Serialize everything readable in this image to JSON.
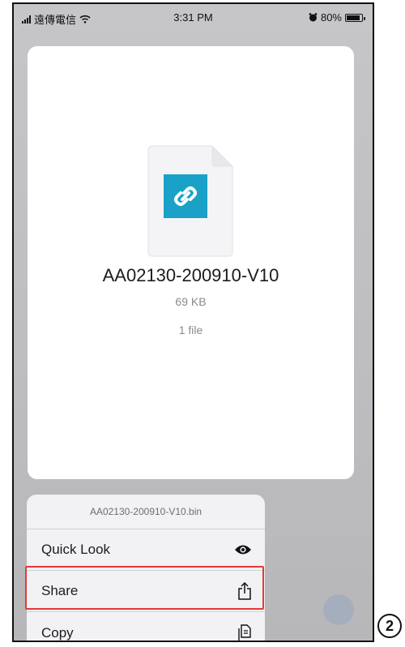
{
  "status_bar": {
    "carrier": "遠傳電信",
    "time": "3:31 PM",
    "battery": "80%",
    "battery_level": 0.8
  },
  "preview": {
    "file_name": "AA02130-200910-V10",
    "file_size": "69 KB",
    "file_count": "1 file",
    "app_color": "#1aa1c8"
  },
  "menu": {
    "header": "AA02130-200910-V10.bin",
    "items": [
      {
        "label": "Quick Look",
        "icon": "eye-icon"
      },
      {
        "label": "Share",
        "icon": "share-icon"
      },
      {
        "label": "Copy",
        "icon": "copy-icon"
      }
    ]
  },
  "annotation": {
    "step": "2",
    "highlight_color": "#e53935"
  }
}
